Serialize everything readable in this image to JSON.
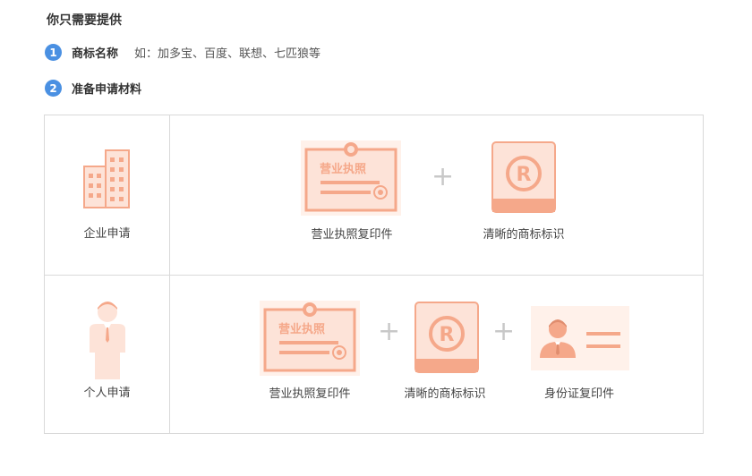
{
  "title": "你只需要提供",
  "steps": [
    {
      "number": "1",
      "label": "商标名称",
      "example": "如：加多宝、百度、联想、七匹狼等"
    },
    {
      "number": "2",
      "label": "准备申请材料"
    }
  ],
  "rows": [
    {
      "applicant": "企业申请",
      "items": [
        {
          "label": "营业执照复印件",
          "doc_text": "营业执照"
        },
        {
          "label": "清晰的商标标识",
          "mark": "R"
        }
      ]
    },
    {
      "applicant": "个人申请",
      "items": [
        {
          "label": "营业执照复印件",
          "doc_text": "营业执照"
        },
        {
          "label": "清晰的商标标识",
          "mark": "R"
        },
        {
          "label": "身份证复印件"
        }
      ]
    }
  ],
  "plus_sign": "+",
  "colors": {
    "accent": "#4a90e2",
    "icon": "#f5a88a",
    "icon_light": "#fde3d8",
    "icon_bg": "#fff1ea"
  }
}
